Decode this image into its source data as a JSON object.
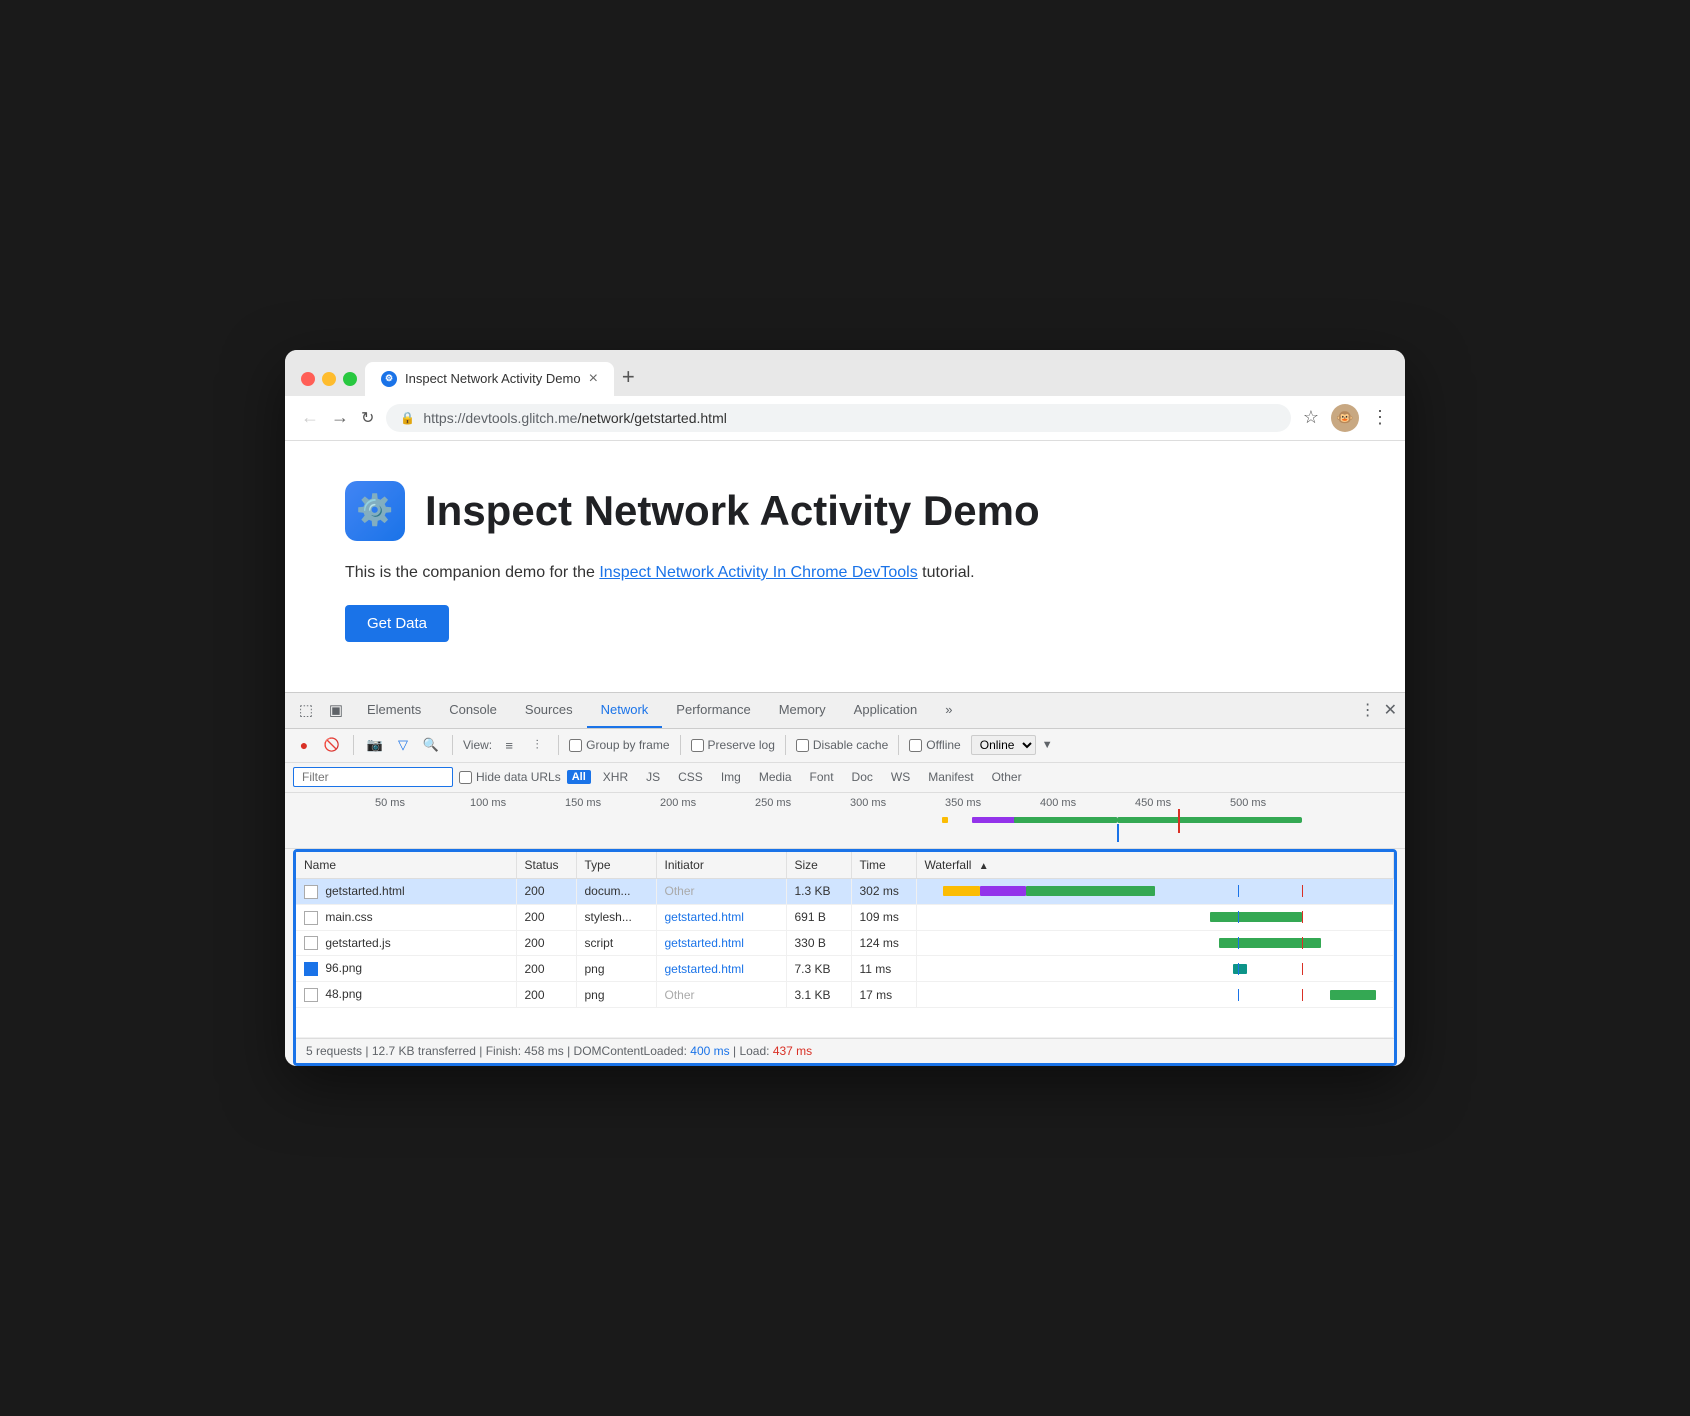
{
  "browser": {
    "tab_title": "Inspect Network Activity Demo",
    "tab_close": "×",
    "tab_new": "+",
    "url": "https://devtools.glitch.me/network/getstarted.html",
    "url_domain": "https://devtools.glitch.me",
    "url_path": "/network/getstarted.html"
  },
  "page": {
    "heading": "Inspect Network Activity Demo",
    "description_before": "This is the companion demo for the ",
    "link_text": "Inspect Network Activity In Chrome DevTools",
    "description_after": " tutorial.",
    "get_data_btn": "Get Data"
  },
  "devtools": {
    "tabs": [
      "Elements",
      "Console",
      "Sources",
      "Network",
      "Performance",
      "Memory",
      "Application",
      "»"
    ],
    "active_tab": "Network",
    "toolbar": {
      "view_label": "View:",
      "group_by_frame": "Group by frame",
      "preserve_log": "Preserve log",
      "disable_cache": "Disable cache",
      "offline_label": "Offline",
      "online_label": "Online"
    },
    "filter": {
      "placeholder": "Filter",
      "hide_data_urls": "Hide data URLs",
      "all_badge": "All",
      "types": [
        "XHR",
        "JS",
        "CSS",
        "Img",
        "Media",
        "Font",
        "Doc",
        "WS",
        "Manifest",
        "Other"
      ]
    },
    "timeline": {
      "labels": [
        "50 ms",
        "100 ms",
        "150 ms",
        "200 ms",
        "250 ms",
        "300 ms",
        "350 ms",
        "400 ms",
        "450 ms",
        "500 ms"
      ]
    },
    "table": {
      "headers": [
        "Name",
        "Status",
        "Type",
        "Initiator",
        "Size",
        "Time",
        "Waterfall"
      ],
      "rows": [
        {
          "name": "getstarted.html",
          "icon": "page",
          "status": "200",
          "type": "docum...",
          "initiator": "Other",
          "initiator_type": "other",
          "size": "1.3 KB",
          "time": "302 ms",
          "waterfall": "mixed"
        },
        {
          "name": "main.css",
          "icon": "page",
          "status": "200",
          "type": "stylesh...",
          "initiator": "getstarted.html",
          "initiator_type": "link",
          "size": "691 B",
          "time": "109 ms",
          "waterfall": "green-right"
        },
        {
          "name": "getstarted.js",
          "icon": "page",
          "status": "200",
          "type": "script",
          "initiator": "getstarted.html",
          "initiator_type": "link",
          "size": "330 B",
          "time": "124 ms",
          "waterfall": "green-right2"
        },
        {
          "name": "96.png",
          "icon": "image",
          "status": "200",
          "type": "png",
          "initiator": "getstarted.html",
          "initiator_type": "link",
          "size": "7.3 KB",
          "time": "11 ms",
          "waterfall": "teal-small"
        },
        {
          "name": "48.png",
          "icon": "page",
          "status": "200",
          "type": "png",
          "initiator": "Other",
          "initiator_type": "other",
          "size": "3.1 KB",
          "time": "17 ms",
          "waterfall": "green-far"
        }
      ]
    },
    "status_bar": {
      "requests": "5 requests",
      "transferred": "12.7 KB transferred",
      "finish": "Finish: 458 ms",
      "dom_content_loaded_label": "DOMContentLoaded:",
      "dom_content_loaded_value": "400 ms",
      "load_label": "Load:",
      "load_value": "437 ms"
    }
  }
}
